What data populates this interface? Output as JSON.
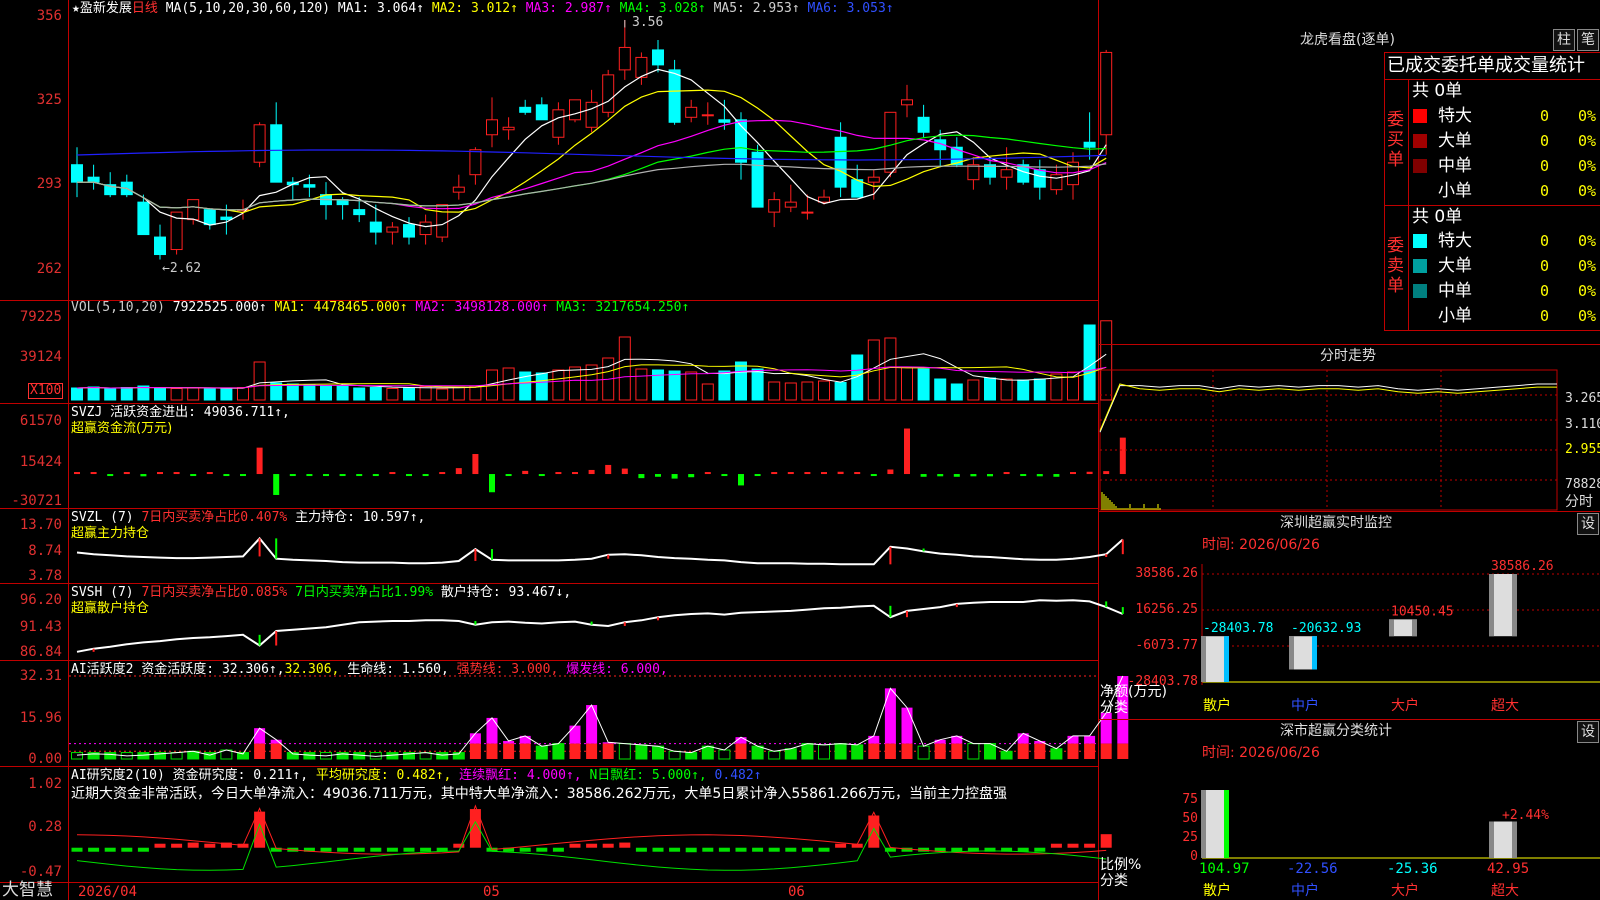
{
  "colors": {
    "up": "#ff2020",
    "down": "#00ffff",
    "frame": "#c00000",
    "ma1": "#ffffff",
    "ma2": "#ffff00",
    "ma3": "#ff00ff",
    "ma4": "#00ff00",
    "ma5": "#b0b0b0",
    "ma6": "#2020ff"
  },
  "main": {
    "star": "★",
    "stock_name": "盈新发展",
    "period": "日线",
    "ma_title": "MA(5,10,20,30,60,120)",
    "ma1": "MA1: 3.064↑",
    "ma2": "MA2: 3.012↑",
    "ma3": "MA3: 2.987↑",
    "ma4": "MA4: 3.028↑",
    "ma5": "MA5: 2.953↑",
    "ma6": "MA6: 3.053↑",
    "hi_label": "3.56",
    "lo_label": "←2.62",
    "y_ticks": [
      "356",
      "325",
      "293",
      "262"
    ]
  },
  "vol": {
    "title": "VOL(5,10,20)",
    "v": "7922525.000↑",
    "ma1": "MA1: 4478465.000↑",
    "ma2": "MA2: 3498128.000↑",
    "ma3": "MA3: 3217654.250↑",
    "y_ticks": [
      "79225",
      "39124"
    ],
    "unit": "X100"
  },
  "svzj": {
    "title": "SVZJ  活跃资金进出: 49036.711↑,",
    "subtitle": "超赢资金流(万元)",
    "y_ticks": [
      "61570",
      "15424",
      "-30721"
    ]
  },
  "svzl": {
    "t1": "SVZL (7) ",
    "t2": "7日内买卖净占比0.407%",
    "t3": " 主力持仓: 10.597↑,",
    "subtitle": "超赢主力持仓",
    "y_ticks": [
      "13.70",
      "8.74",
      "3.78"
    ]
  },
  "svsh": {
    "t1": "SVSH (7) ",
    "t2": "7日内买卖净占比0.085%",
    "t3": " 7日内买卖净占比1.99%",
    "t4": " 散户持仓: 93.467↓,",
    "subtitle": "超赢散户持仓",
    "y_ticks": [
      "96.20",
      "91.43",
      "86.84"
    ]
  },
  "ai2": {
    "t1": "AI活跃度2 资金活跃度: 32.306↑,",
    "t2": "32.306,",
    "t3": " 生命线: 1.560,",
    "t4": " 强势线: 3.000,",
    "t5": " 爆发线: 6.000,",
    "y_ticks": [
      "32.31",
      "15.96",
      "0.00"
    ]
  },
  "ai_research": {
    "t1": "AI研究度2(10) 资金研究度: 0.211↑,",
    "t2": " 平均研究度: 0.482↑,",
    "t3": " 连续飘红: 4.000↑,",
    "t4": " N日飘红: 5.000↑,",
    "t5": " 0.482↑",
    "text": "近期大资金非常活跃，今日大单净流入：49036.711万元，其中特大单净流入：38586.262万元，大单5日累计净入55861.266万元，当前主力控盘强",
    "y_ticks": [
      "1.02",
      "0.28",
      "-0.47"
    ]
  },
  "dates": [
    "2026/04",
    "05",
    "06"
  ],
  "bottom_left": "大智慧",
  "lhb": {
    "title": "龙虎看盘(逐单)",
    "btn1": "柱",
    "btn2": "笔",
    "header": "已成交委托单成交量统计",
    "buy": "委买单",
    "sell": "委卖单",
    "buy_total": "共 0单",
    "sell_total": "共 0单",
    "buy_rows": [
      {
        "name": "特大",
        "v": "0",
        "p": "0%",
        "c": "#ff0000"
      },
      {
        "name": "大单",
        "v": "0",
        "p": "0%",
        "c": "#a00000"
      },
      {
        "name": "中单",
        "v": "0",
        "p": "0%",
        "c": "#800000"
      },
      {
        "name": "小单",
        "v": "0",
        "p": "0%",
        "c": "#000000"
      }
    ],
    "sell_rows": [
      {
        "name": "特大",
        "v": "0",
        "p": "0%",
        "c": "#00ffff"
      },
      {
        "name": "大单",
        "v": "0",
        "p": "0%",
        "c": "#00a0a0"
      },
      {
        "name": "中单",
        "v": "0",
        "p": "0%",
        "c": "#008080"
      },
      {
        "name": "小单",
        "v": "0",
        "p": "0%",
        "c": "#000000"
      }
    ]
  },
  "intraday": {
    "title": "分时走势",
    "y_labels": [
      "3.265",
      "3.110",
      "2.955"
    ],
    "vol_label": "78828",
    "fen": "分时"
  },
  "szmon": {
    "title": "深圳超赢实时监控",
    "btn": "设",
    "time": "时间: 2026/06/26",
    "y_ticks": [
      "38586.26",
      "16256.25",
      "-6073.77",
      "-28403.78"
    ],
    "ylabel1": "净额(万元)",
    "ylabel2": "分类"
  },
  "szcls": {
    "title": "深市超赢分类统计",
    "btn": "设",
    "time": "时间: 2026/06/26",
    "y_ticks": [
      "75",
      "50",
      "25",
      "0"
    ],
    "ylabel1": "比例%",
    "ylabel2": "分类",
    "pct_label": "+2.44%"
  },
  "chart_data": [
    {
      "type": "candlestick",
      "name": "盈新发展 日线",
      "ylim": [
        2.55,
        3.6
      ],
      "y_ticks": [
        3.56,
        3.25,
        2.93,
        2.62
      ],
      "ohlc": [
        [
          2.98,
          3.05,
          2.85,
          2.91
        ],
        [
          2.93,
          2.98,
          2.88,
          2.91
        ],
        [
          2.9,
          2.95,
          2.85,
          2.86
        ],
        [
          2.91,
          2.94,
          2.85,
          2.86
        ],
        [
          2.83,
          2.86,
          2.7,
          2.7
        ],
        [
          2.69,
          2.74,
          2.6,
          2.62
        ],
        [
          2.64,
          2.79,
          2.62,
          2.79
        ],
        [
          2.76,
          2.84,
          2.74,
          2.84
        ],
        [
          2.8,
          2.8,
          2.72,
          2.74
        ],
        [
          2.77,
          2.82,
          2.7,
          2.76
        ],
        [
          2.8,
          2.84,
          2.76,
          2.8
        ],
        [
          2.99,
          3.15,
          2.97,
          3.14
        ],
        [
          3.14,
          3.23,
          2.98,
          2.91
        ],
        [
          2.91,
          2.93,
          2.84,
          2.9
        ],
        [
          2.9,
          2.94,
          2.85,
          2.89
        ],
        [
          2.86,
          2.91,
          2.76,
          2.82
        ],
        [
          2.84,
          2.85,
          2.76,
          2.82
        ],
        [
          2.8,
          2.85,
          2.75,
          2.78
        ],
        [
          2.75,
          2.82,
          2.66,
          2.71
        ],
        [
          2.71,
          2.75,
          2.66,
          2.73
        ],
        [
          2.74,
          2.77,
          2.66,
          2.69
        ],
        [
          2.7,
          2.78,
          2.66,
          2.75
        ],
        [
          2.69,
          2.82,
          2.67,
          2.82
        ],
        [
          2.87,
          2.94,
          2.84,
          2.89
        ],
        [
          2.94,
          3.05,
          2.9,
          3.04
        ],
        [
          3.1,
          3.25,
          3.05,
          3.16
        ],
        [
          3.12,
          3.17,
          3.08,
          3.13
        ],
        [
          3.21,
          3.24,
          3.18,
          3.19
        ],
        [
          3.22,
          3.25,
          3.17,
          3.16
        ],
        [
          3.09,
          3.23,
          3.06,
          3.2
        ],
        [
          3.16,
          3.24,
          3.15,
          3.24
        ],
        [
          3.13,
          3.28,
          3.11,
          3.23
        ],
        [
          3.19,
          3.36,
          3.17,
          3.34
        ],
        [
          3.36,
          3.56,
          3.32,
          3.45
        ],
        [
          3.33,
          3.43,
          3.3,
          3.41
        ],
        [
          3.44,
          3.48,
          3.35,
          3.38
        ],
        [
          3.36,
          3.4,
          3.14,
          3.15
        ],
        [
          3.17,
          3.24,
          3.15,
          3.21
        ],
        [
          3.18,
          3.23,
          3.14,
          3.18
        ],
        [
          3.16,
          3.24,
          3.12,
          3.15
        ],
        [
          3.16,
          3.19,
          2.92,
          2.99
        ],
        [
          3.03,
          3.06,
          2.82,
          2.81
        ],
        [
          2.79,
          2.87,
          2.73,
          2.84
        ],
        [
          2.81,
          2.9,
          2.79,
          2.83
        ],
        [
          2.79,
          2.86,
          2.76,
          2.79
        ],
        [
          2.83,
          2.88,
          2.82,
          2.85
        ],
        [
          3.09,
          3.15,
          2.85,
          2.89
        ],
        [
          2.92,
          2.98,
          2.85,
          2.85
        ],
        [
          2.91,
          2.96,
          2.84,
          2.93
        ],
        [
          2.95,
          3.18,
          2.93,
          3.19
        ],
        [
          3.22,
          3.3,
          3.17,
          3.24
        ],
        [
          3.17,
          3.22,
          3.09,
          3.11
        ],
        [
          3.08,
          3.12,
          2.97,
          3.04
        ],
        [
          3.05,
          3.09,
          2.97,
          2.98
        ],
        [
          2.92,
          3.01,
          2.88,
          2.98
        ],
        [
          2.98,
          3.01,
          2.9,
          2.93
        ],
        [
          2.93,
          3.05,
          2.88,
          2.96
        ],
        [
          2.98,
          3.0,
          2.9,
          2.91
        ],
        [
          2.96,
          3.0,
          2.84,
          2.89
        ],
        [
          2.88,
          2.98,
          2.86,
          2.94
        ],
        [
          2.9,
          3.03,
          2.84,
          2.99
        ],
        [
          3.07,
          3.19,
          3.0,
          3.05
        ],
        [
          3.1,
          3.44,
          3.02,
          3.43
        ]
      ]
    },
    {
      "type": "bar",
      "name": "VOL",
      "ylim": [
        0,
        90000
      ],
      "unit": "X100",
      "values": [
        12000,
        13000,
        11000,
        12500,
        14000,
        12000,
        11500,
        12000,
        11000,
        12000,
        12500,
        38000,
        17000,
        16000,
        15500,
        14000,
        14500,
        12000,
        12500,
        11500,
        12000,
        13500,
        11000,
        13000,
        14000,
        30000,
        32000,
        28000,
        27000,
        30000,
        33000,
        35000,
        42000,
        63000,
        31000,
        30000,
        29000,
        28000,
        16000,
        29000,
        38000,
        31000,
        18000,
        17000,
        18000,
        19000,
        17500,
        45000,
        60000,
        62000,
        33000,
        31000,
        21000,
        16000,
        20000,
        22000,
        21000,
        20000,
        21000,
        26000,
        28000,
        75000,
        79225
      ]
    },
    {
      "type": "bar",
      "name": "SVZJ",
      "ylim": [
        -30721,
        61570
      ],
      "values": [
        800,
        600,
        -1500,
        500,
        -2500,
        600,
        800,
        -1200,
        700,
        -1000,
        -1000,
        29000,
        -23000,
        -1500,
        -1000,
        -1200,
        -1100,
        -800,
        -1000,
        600,
        -1000,
        -1000,
        1000,
        6500,
        22000,
        -20000,
        -1500,
        3500,
        -900,
        800,
        2000,
        4500,
        10000,
        6000,
        -4500,
        -3000,
        -5000,
        -3500,
        500,
        -1800,
        -12500,
        -1000,
        1000,
        700,
        1200,
        2000,
        2500,
        400,
        -1100,
        5000,
        50000,
        -3000,
        -2500,
        -3000,
        -2500,
        -2500,
        1500,
        -1500,
        -2500,
        -3000,
        2000,
        2500,
        3200,
        40000
      ]
    },
    {
      "type": "line",
      "name": "SVZL 主力持仓",
      "ylim": [
        3.78,
        13.7
      ],
      "values": [
        8.3,
        8.0,
        7.8,
        7.6,
        7.5,
        7.4,
        7.3,
        7.3,
        7.4,
        7.5,
        7.6,
        10.8,
        7.2,
        7.0,
        6.9,
        6.8,
        6.6,
        6.5,
        6.5,
        6.5,
        6.4,
        6.4,
        6.5,
        6.8,
        8.9,
        7.0,
        6.9,
        6.9,
        6.9,
        6.9,
        7.0,
        7.2,
        7.9,
        8.0,
        7.8,
        7.5,
        7.3,
        7.2,
        7.0,
        6.9,
        6.6,
        6.4,
        6.4,
        6.4,
        6.3,
        6.3,
        6.2,
        6.2,
        6.2,
        9.3,
        9.0,
        8.5,
        8.1,
        7.9,
        7.6,
        7.5,
        7.3,
        7.1,
        7.0,
        7.0,
        7.2,
        7.5,
        8.0,
        10.6
      ]
    },
    {
      "type": "line",
      "name": "SVSH 散户持仓",
      "ylim": [
        86.84,
        96.2
      ],
      "values": [
        87.5,
        88.0,
        88.3,
        88.7,
        89.0,
        89.2,
        89.5,
        89.7,
        89.8,
        90.0,
        90.2,
        88.5,
        90.8,
        91.0,
        91.2,
        91.4,
        91.8,
        92.2,
        92.3,
        92.4,
        92.4,
        92.5,
        92.5,
        92.4,
        91.8,
        92.2,
        92.3,
        92.1,
        92.0,
        92.2,
        92.3,
        91.8,
        91.6,
        92.2,
        92.5,
        93.0,
        93.3,
        93.5,
        93.6,
        93.4,
        93.7,
        93.8,
        93.9,
        94.0,
        94.2,
        94.4,
        94.5,
        94.7,
        94.8,
        93.0,
        94.0,
        94.3,
        94.6,
        95.1,
        95.3,
        95.4,
        95.4,
        95.4,
        95.7,
        95.6,
        95.7,
        95.5,
        94.6,
        93.5
      ]
    },
    {
      "type": "bar",
      "name": "AI活跃度2",
      "ylim": [
        0,
        32.31
      ],
      "hlines": [
        1.56,
        3.0,
        6.0
      ],
      "values": [
        1.5,
        2.0,
        1.8,
        1.2,
        1.5,
        2.0,
        2.5,
        3.0,
        1.5,
        3.5,
        2.0,
        12.0,
        7.5,
        2.0,
        1.5,
        1.2,
        2.0,
        1.5,
        1.0,
        1.5,
        2.0,
        2.5,
        1.5,
        2.0,
        10.0,
        16.0,
        7.0,
        9.0,
        5.0,
        6.0,
        13.0,
        21.0,
        6.5,
        6.0,
        5.5,
        5.0,
        3.0,
        2.5,
        5.0,
        3.5,
        8.5,
        5.0,
        3.0,
        4.0,
        6.0,
        5.5,
        6.0,
        5.5,
        9.0,
        27.5,
        20.0,
        5.0,
        7.5,
        9.0,
        6.0,
        6.0,
        3.0,
        10.0,
        7.0,
        4.0,
        9.0,
        9.0,
        18.0,
        32.3
      ]
    },
    {
      "type": "bar",
      "name": "AI研究度2(10)",
      "ylim": [
        -0.47,
        1.02
      ],
      "avg": 0.482,
      "values": [
        -0.05,
        -0.05,
        -0.05,
        -0.03,
        0.0,
        0.02,
        0.04,
        0.08,
        0.05,
        0.08,
        0.05,
        0.56,
        -0.06,
        -0.06,
        -0.06,
        -0.06,
        -0.05,
        -0.05,
        -0.05,
        -0.05,
        -0.05,
        -0.05,
        -0.05,
        0.05,
        0.6,
        -0.05,
        -0.05,
        -0.05,
        -0.05,
        -0.05,
        0.02,
        0.03,
        0.05,
        0.08,
        -0.05,
        -0.05,
        -0.05,
        -0.07,
        -0.06,
        -0.06,
        -0.06,
        -0.05,
        -0.04,
        -0.02,
        -0.02,
        -0.01,
        0.01,
        0.01,
        0.5,
        -0.03,
        -0.03,
        -0.03,
        -0.03,
        -0.05,
        -0.05,
        -0.05,
        -0.05,
        -0.05,
        0.0,
        0.01,
        0.02,
        0.03,
        0.21
      ]
    },
    {
      "type": "line",
      "name": "分时走势",
      "ylim": [
        2.9,
        3.35
      ],
      "values": [
        2.95,
        3.25,
        3.25,
        3.24,
        3.25,
        3.25,
        3.23,
        3.25,
        3.24,
        3.25,
        3.24,
        3.25,
        3.25,
        3.24,
        3.25,
        3.23,
        3.22,
        3.23,
        3.22,
        3.23,
        3.24,
        3.25,
        3.26,
        3.26
      ]
    },
    {
      "type": "bar",
      "name": "深圳超赢实时监控",
      "ylim": [
        -28403.78,
        38586.26
      ],
      "categories": [
        "散户",
        "中户",
        "大户",
        "超大"
      ],
      "values": [
        -28403.78,
        -20632.93,
        10450.45,
        38586.26
      ]
    },
    {
      "type": "bar",
      "name": "深市超赢分类统计",
      "ylim": [
        0,
        80
      ],
      "categories": [
        "散户",
        "中户",
        "大户",
        "超大"
      ],
      "values": [
        104.97,
        -22.56,
        -25.36,
        42.95
      ],
      "labels": [
        "104.97",
        "-22.56",
        "-25.36",
        "42.95"
      ]
    }
  ]
}
